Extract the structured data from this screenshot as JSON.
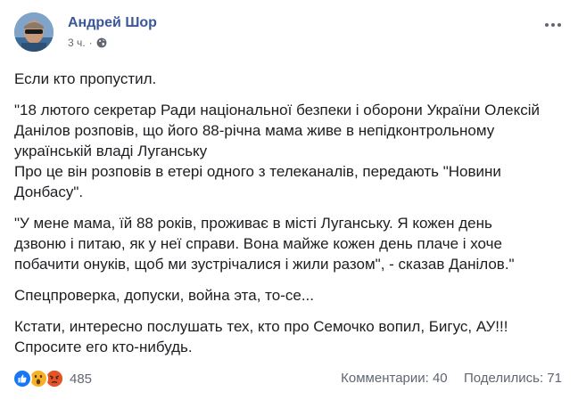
{
  "post": {
    "author": "Андрей Шор",
    "time": "3 ч.",
    "time_separator": "·",
    "privacy_icon": "globe-icon",
    "paragraphs": [
      [
        "Если кто пропустил."
      ],
      [
        "\"18 лютого секретар Ради національної безпеки і оборони України Олексій",
        "Данілов розповів, що його 88-річна мама живе в непідконтрольному",
        "українській владі Луганську",
        "Про це він розповів в етері одного з телеканалів, передають \"Новини",
        "Донбасу\"."
      ],
      [
        "\"У мене мама, їй 88 років, проживає в місті Луганську. Я кожен день",
        "дзвоню і питаю, як у неї справи. Вона майже кожен день плаче і хоче",
        "побачити онуків, щоб ми зустрічалися і жили разом\", - сказав Данілов.\""
      ],
      [
        "Спецпроверка, допуски, война эта, то-се..."
      ],
      [
        "Кстати, интересно послушать тех, кто про Семочко вопил, Бигус, АУ!!!",
        "Спросите его кто-нибудь."
      ]
    ]
  },
  "footer": {
    "reactions": [
      "like-icon",
      "wow-icon",
      "angry-icon"
    ],
    "reaction_count": "485",
    "comments": "Комментарии: 40",
    "shares": "Поделились: 71"
  },
  "colors": {
    "author": "#385898",
    "secondary": "#606770",
    "text": "#1c1e21",
    "like": "#1877f2",
    "wow": "#f7b125",
    "angry": "#e9710f"
  }
}
